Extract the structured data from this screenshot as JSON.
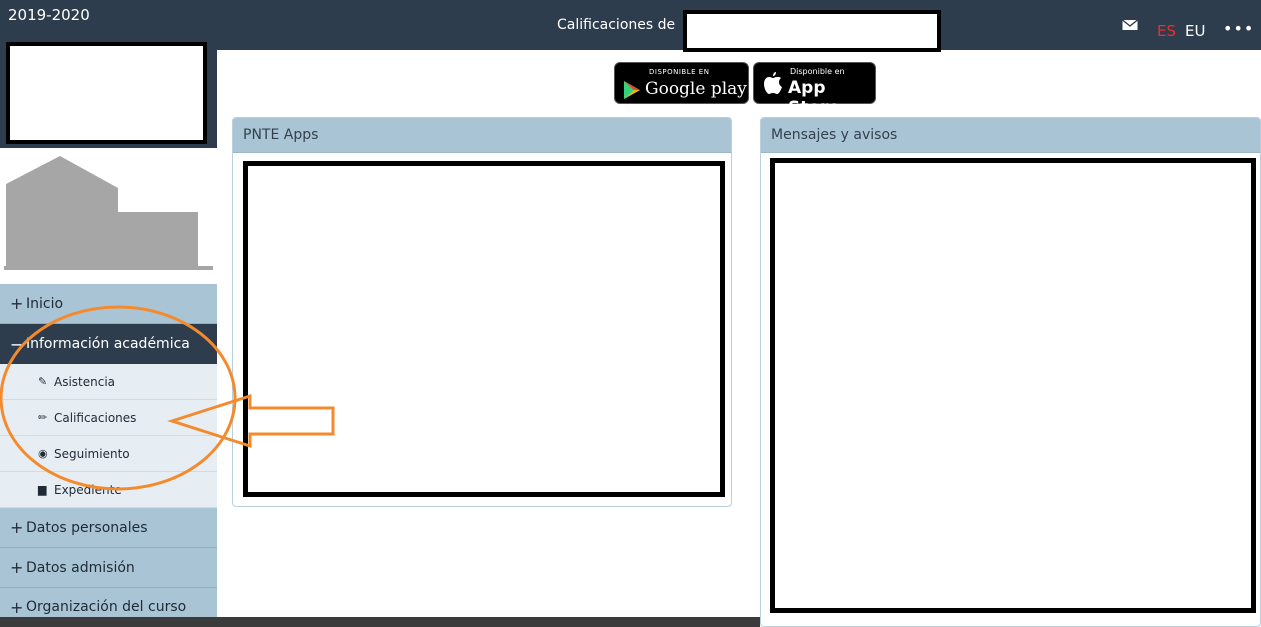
{
  "sidebar": {
    "year": "2019-2020",
    "menu": [
      {
        "sign": "+",
        "label": "Inicio"
      },
      {
        "sign": "−",
        "label": "Información académica"
      },
      {
        "sign": "+",
        "label": "Datos personales"
      },
      {
        "sign": "+",
        "label": "Datos admisión"
      },
      {
        "sign": "+",
        "label": "Organización del curso"
      }
    ],
    "submenu": [
      {
        "icon": "✎",
        "icon_name": "edit-icon",
        "label": "Asistencia"
      },
      {
        "icon": "✏",
        "icon_name": "pencil-icon",
        "label": "Calificaciones"
      },
      {
        "icon": "◉",
        "icon_name": "eye-icon",
        "label": "Seguimiento"
      },
      {
        "icon": "▆",
        "icon_name": "folder-icon",
        "label": "Expediente"
      }
    ]
  },
  "header": {
    "title": "Calificaciones de",
    "lang_es": "ES",
    "lang_eu": "EU",
    "more": "•••",
    "icons": [
      "envelope-icon",
      "more-icon"
    ]
  },
  "badges": {
    "google_small": "DISPONIBLE EN",
    "google_big": "Google play",
    "apple_small": "Disponible en",
    "apple_big": "App Store"
  },
  "panels": {
    "apps_title": "PNTE Apps",
    "messages_title": "Mensajes y avisos"
  },
  "colors": {
    "dark_bar": "#2e3d4d",
    "menu_light": "#a9c5d5",
    "active_lang": "#e8302f",
    "annotation": "#f58a2d"
  }
}
